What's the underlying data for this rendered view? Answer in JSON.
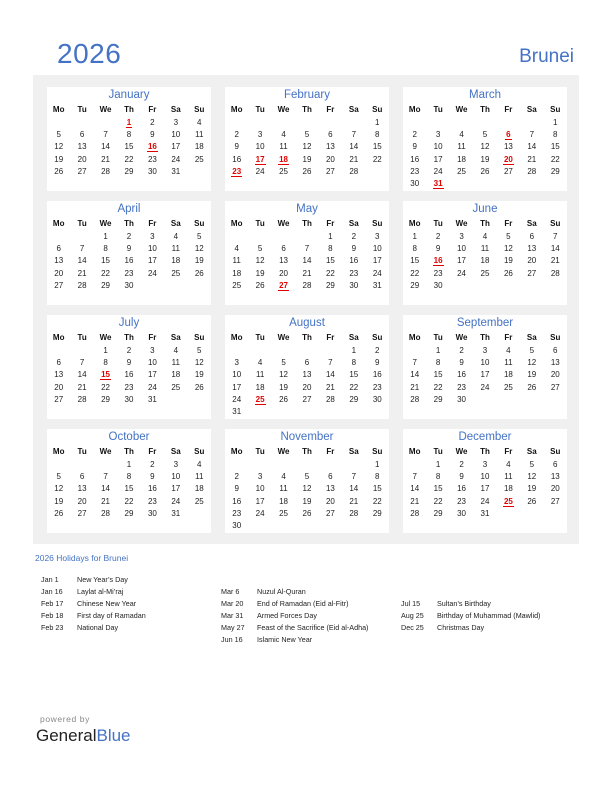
{
  "header": {
    "year": "2026",
    "country": "Brunei"
  },
  "weekdays": [
    "Mo",
    "Tu",
    "We",
    "Th",
    "Fr",
    "Sa",
    "Su"
  ],
  "months": [
    {
      "name": "January",
      "offset": 3,
      "days": 31,
      "holidays": [
        1,
        16
      ]
    },
    {
      "name": "February",
      "offset": 6,
      "days": 28,
      "holidays": [
        17,
        18,
        23
      ]
    },
    {
      "name": "March",
      "offset": 6,
      "days": 31,
      "holidays": [
        6,
        20,
        31
      ]
    },
    {
      "name": "April",
      "offset": 2,
      "days": 30,
      "holidays": []
    },
    {
      "name": "May",
      "offset": 4,
      "days": 31,
      "holidays": [
        27
      ]
    },
    {
      "name": "June",
      "offset": 0,
      "days": 30,
      "holidays": [
        16
      ]
    },
    {
      "name": "July",
      "offset": 2,
      "days": 31,
      "holidays": [
        15
      ]
    },
    {
      "name": "August",
      "offset": 5,
      "days": 31,
      "holidays": [
        25
      ]
    },
    {
      "name": "September",
      "offset": 1,
      "days": 30,
      "holidays": []
    },
    {
      "name": "October",
      "offset": 3,
      "days": 31,
      "holidays": []
    },
    {
      "name": "November",
      "offset": 6,
      "days": 30,
      "holidays": []
    },
    {
      "name": "December",
      "offset": 1,
      "days": 31,
      "holidays": [
        25
      ]
    }
  ],
  "holidays_section": {
    "title": "2026 Holidays for Brunei",
    "columns": [
      [
        {
          "date": "Jan 1",
          "name": "New Year’s Day"
        },
        {
          "date": "Jan 16",
          "name": "Laylat al-Mi’raj"
        },
        {
          "date": "Feb 17",
          "name": "Chinese New Year"
        },
        {
          "date": "Feb 18",
          "name": "First day of Ramadan"
        },
        {
          "date": "Feb 23",
          "name": "National Day"
        }
      ],
      [
        {
          "date": "Mar 6",
          "name": "Nuzul Al-Quran"
        },
        {
          "date": "Mar 20",
          "name": "End of Ramadan (Eid al-Fitr)"
        },
        {
          "date": "Mar 31",
          "name": "Armed Forces Day"
        },
        {
          "date": "May 27",
          "name": "Feast of the Sacrifice (Eid al-Adha)"
        },
        {
          "date": "Jun 16",
          "name": "Islamic New Year"
        }
      ],
      [
        {
          "date": "Jul 15",
          "name": "Sultan’s Birthday"
        },
        {
          "date": "Aug 25",
          "name": "Birthday of Muhammad (Mawlid)"
        },
        {
          "date": "Dec 25",
          "name": "Christmas Day"
        }
      ]
    ]
  },
  "footer": {
    "powered_by": "powered by",
    "brand_general": "General",
    "brand_blue": "Blue"
  },
  "colors": {
    "accent": "#4472c4",
    "holiday": "#e00000",
    "panel": "#f0f0f0"
  }
}
